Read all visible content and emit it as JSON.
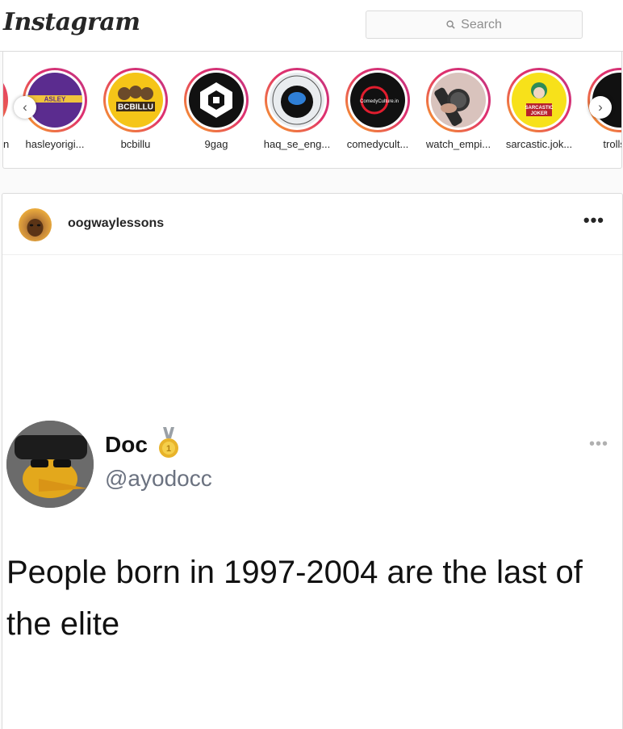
{
  "header": {
    "logo": "Instagram",
    "search": {
      "placeholder": "Search"
    }
  },
  "stories": [
    {
      "username": "hasleyorigi...",
      "avatar": "hasley-logo",
      "color": "#5b2c8f"
    },
    {
      "username": "bcbillu",
      "avatar": "bcbillu-logo",
      "color": "#f5c518"
    },
    {
      "username": "9gag",
      "avatar": "9gag-logo",
      "color": "#111111"
    },
    {
      "username": "haq_se_eng...",
      "avatar": "engineering-brain-logo",
      "color": "#123a6b"
    },
    {
      "username": "comedycult...",
      "avatar": "comedyculture-logo",
      "color": "#111111"
    },
    {
      "username": "watch_empi...",
      "avatar": "watch-photo",
      "color": "#d9c3bd"
    },
    {
      "username": "sarcastic.jok...",
      "avatar": "joker-logo",
      "color": "#f7e11a"
    },
    {
      "username": "trolls_c",
      "avatar": "trolls-logo",
      "color": "#111111"
    }
  ],
  "story_nav": {
    "prev": "‹",
    "next": "›"
  },
  "post": {
    "username": "oogwaylessons",
    "more": "•••",
    "tweet": {
      "name": "Doc",
      "handle": "@ayodocc",
      "text": "People born in 1997-2004 are the last of the elite",
      "more": "•••"
    }
  }
}
